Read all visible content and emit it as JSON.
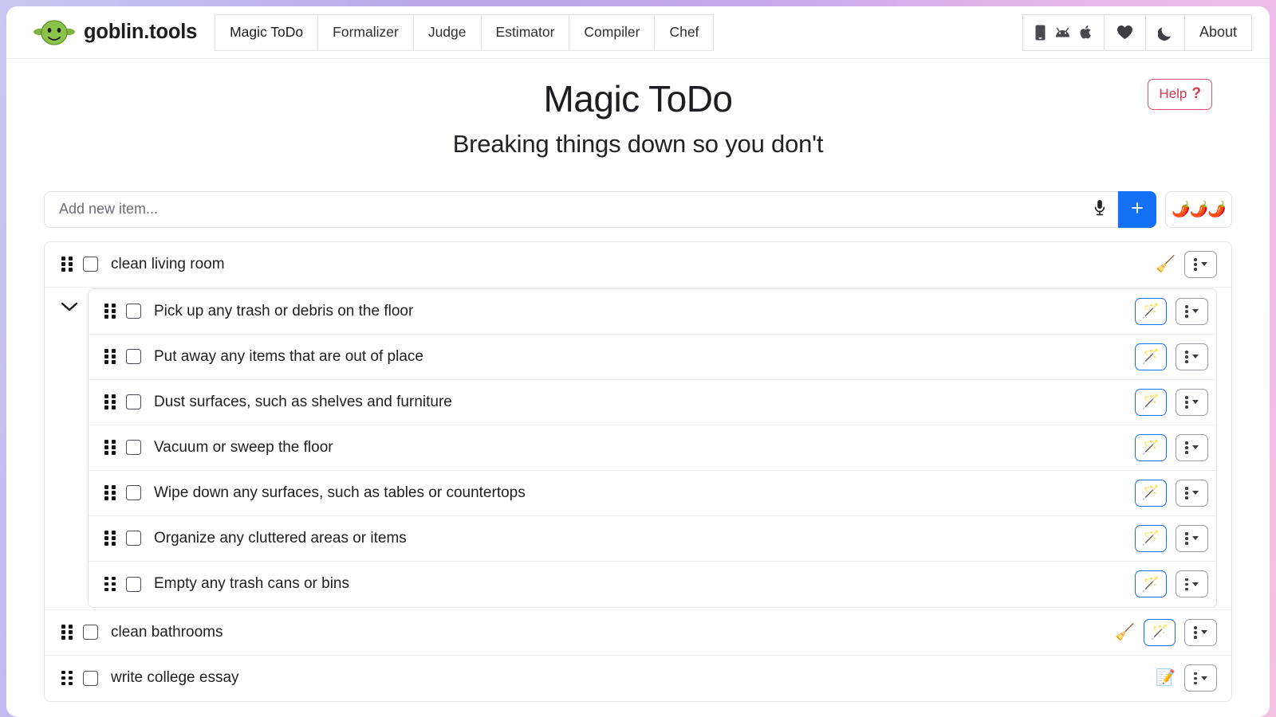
{
  "brand": {
    "name": "goblin.tools",
    "logo_icon": "goblin-face-icon"
  },
  "nav": {
    "tabs": [
      {
        "label": "Magic ToDo",
        "active": true
      },
      {
        "label": "Formalizer",
        "active": false
      },
      {
        "label": "Judge",
        "active": false
      },
      {
        "label": "Estimator",
        "active": false
      },
      {
        "label": "Compiler",
        "active": false
      },
      {
        "label": "Chef",
        "active": false
      }
    ],
    "platform_icons": [
      "phone-icon",
      "android-icon",
      "apple-icon"
    ],
    "favorite_icon": "heart-icon",
    "theme_icon": "moon-icon",
    "about_label": "About"
  },
  "header": {
    "title": "Magic ToDo",
    "subtitle": "Breaking things down so you don't",
    "help_label": "Help",
    "help_mark": "?",
    "help_color": "#cf3a52"
  },
  "composer": {
    "placeholder": "Add new item...",
    "value": "",
    "mic_icon": "microphone-icon",
    "add_label": "+",
    "add_color": "#1471f5",
    "spiciness": "🌶️🌶️🌶️"
  },
  "tasks": [
    {
      "text": "clean living room",
      "checked": false,
      "actions": [
        "🧹"
      ],
      "has_wand": false,
      "subtasks": [
        {
          "text": "Pick up any trash or debris on the floor",
          "checked": false
        },
        {
          "text": "Put away any items that are out of place",
          "checked": false
        },
        {
          "text": "Dust surfaces, such as shelves and furniture",
          "checked": false
        },
        {
          "text": "Vacuum or sweep the floor",
          "checked": false
        },
        {
          "text": "Wipe down any surfaces, such as tables or countertops",
          "checked": false
        },
        {
          "text": "Organize any cluttered areas or items",
          "checked": false
        },
        {
          "text": "Empty any trash cans or bins",
          "checked": false
        }
      ],
      "expanded": true
    },
    {
      "text": "clean bathrooms",
      "checked": false,
      "actions": [
        "🧹"
      ],
      "has_wand": true,
      "subtasks": [],
      "expanded": false
    },
    {
      "text": "write college essay",
      "checked": false,
      "actions": [
        "📝"
      ],
      "has_wand": false,
      "subtasks": [],
      "expanded": false
    }
  ],
  "icons": {
    "wand": "🪄",
    "menu": "kebab-menu-icon"
  }
}
